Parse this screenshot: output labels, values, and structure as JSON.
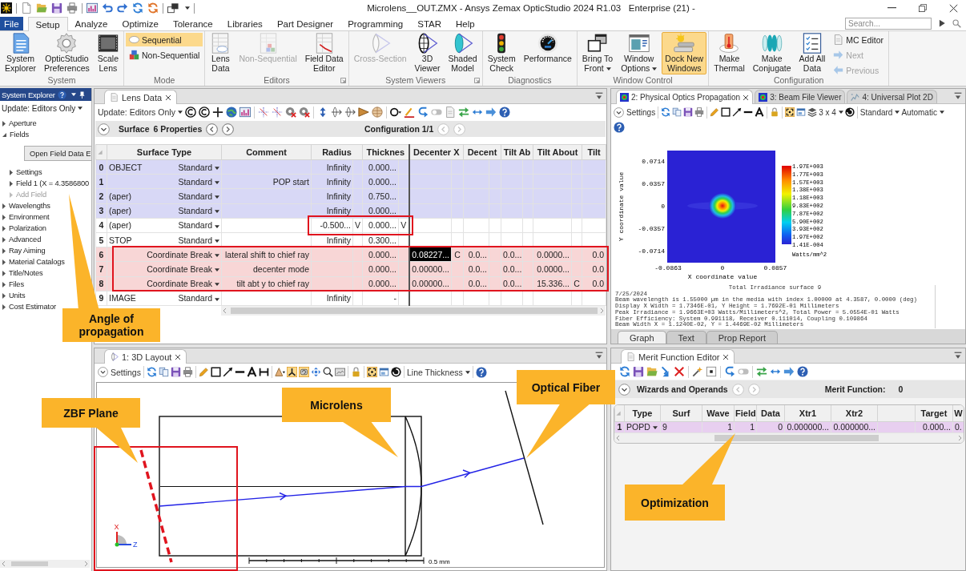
{
  "title_bar": {
    "title": "Microlens__OUT.ZMX - Ansys Zemax OpticStudio 2024 R1.03   Enterprise (21) -"
  },
  "ribbon": {
    "tabs": [
      {
        "label": "File",
        "kind": "file",
        "selected": false
      },
      {
        "label": "Setup",
        "kind": "tab",
        "selected": true
      },
      {
        "label": "Analyze",
        "kind": "tab",
        "selected": false
      },
      {
        "label": "Optimize",
        "kind": "tab",
        "selected": false
      },
      {
        "label": "Tolerance",
        "kind": "tab",
        "selected": false
      },
      {
        "label": "Libraries",
        "kind": "tab",
        "selected": false
      },
      {
        "label": "Part Designer",
        "kind": "tab",
        "selected": false
      },
      {
        "label": "Programming",
        "kind": "tab",
        "selected": false
      },
      {
        "label": "STAR",
        "kind": "tab",
        "selected": false
      },
      {
        "label": "Help",
        "kind": "tab",
        "selected": false
      }
    ],
    "search": {
      "placeholder": "Search..."
    },
    "groups": [
      {
        "label": "System",
        "launcher": false,
        "items": [
          {
            "label": "System\nExplorer",
            "kind": "large",
            "disabled": false,
            "on": false
          },
          {
            "label": "OpticStudio\nPreferences",
            "kind": "large",
            "disabled": false,
            "on": false
          },
          {
            "label": "Scale\nLens",
            "kind": "large",
            "disabled": false,
            "on": false
          }
        ]
      },
      {
        "label": "Mode",
        "launcher": false,
        "items": [
          {
            "label": "Sequential",
            "kind": "small",
            "disabled": false,
            "on": true
          },
          {
            "label": "Non-Sequential",
            "kind": "small",
            "disabled": false,
            "on": false
          }
        ]
      },
      {
        "label": "Editors",
        "launcher": true,
        "items": [
          {
            "label": "Lens\nData",
            "kind": "large",
            "disabled": false,
            "on": false
          },
          {
            "label": "Non-Sequential",
            "kind": "large",
            "disabled": true,
            "on": false
          },
          {
            "label": "Field Data\nEditor",
            "kind": "large",
            "disabled": false,
            "on": false
          }
        ]
      },
      {
        "label": "System Viewers",
        "launcher": true,
        "items": [
          {
            "label": "Cross-Section",
            "kind": "large",
            "disabled": true,
            "on": false
          },
          {
            "label": "3D\nViewer",
            "kind": "large",
            "disabled": false,
            "on": false
          },
          {
            "label": "Shaded\nModel",
            "kind": "large",
            "disabled": false,
            "on": false
          }
        ]
      },
      {
        "label": "Diagnostics",
        "launcher": false,
        "items": [
          {
            "label": "System\nCheck",
            "kind": "large",
            "disabled": false,
            "on": false
          },
          {
            "label": "Performance",
            "kind": "large",
            "disabled": false,
            "on": false
          }
        ]
      },
      {
        "label": "Window Control",
        "launcher": false,
        "items": [
          {
            "label": "Bring To\nFront",
            "kind": "split",
            "disabled": false,
            "on": false
          },
          {
            "label": "Window\nOptions",
            "kind": "split",
            "disabled": false,
            "on": false
          },
          {
            "label": "Dock New\nWindows",
            "kind": "large",
            "disabled": false,
            "on": true
          }
        ]
      },
      {
        "label": "Configuration",
        "launcher": false,
        "items": [
          {
            "label": "Make\nThermal",
            "kind": "large",
            "disabled": false,
            "on": false
          },
          {
            "label": "Make\nConjugate",
            "kind": "large",
            "disabled": false,
            "on": false
          },
          {
            "label": "Add All\nData",
            "kind": "large",
            "disabled": false,
            "on": false
          },
          {
            "label": "MC Editor",
            "kind": "small",
            "disabled": false,
            "on": false
          },
          {
            "label": "Next",
            "kind": "small",
            "disabled": true,
            "on": false
          },
          {
            "label": "Previous",
            "kind": "small",
            "disabled": true,
            "on": false
          }
        ]
      }
    ]
  },
  "system_explorer": {
    "title": "System Explorer",
    "update": "Update: Editors Only",
    "tree": [
      {
        "label": "Aperture",
        "expanded": false,
        "disabled": false
      },
      {
        "label": "Fields",
        "expanded": true,
        "disabled": false,
        "button": "Open Field Data E",
        "children": [
          {
            "label": "Settings",
            "expanded": false,
            "disabled": false
          },
          {
            "label": "Field 1 (X = 4.3586800",
            "expanded": false,
            "disabled": false
          },
          {
            "label": "Add Field",
            "expanded": false,
            "disabled": true
          }
        ]
      },
      {
        "label": "Wavelengths",
        "expanded": false,
        "disabled": false
      },
      {
        "label": "Environment",
        "expanded": false,
        "disabled": false
      },
      {
        "label": "Polarization",
        "expanded": false,
        "disabled": false
      },
      {
        "label": "Advanced",
        "expanded": false,
        "disabled": false
      },
      {
        "label": "Ray Aiming",
        "expanded": false,
        "disabled": false
      },
      {
        "label": "Material Catalogs",
        "expanded": false,
        "disabled": false
      },
      {
        "label": "Title/Notes",
        "expanded": false,
        "disabled": false
      },
      {
        "label": "Files",
        "expanded": false,
        "disabled": false
      },
      {
        "label": "Units",
        "expanded": false,
        "disabled": false
      },
      {
        "label": "Cost Estimator",
        "expanded": false,
        "disabled": false
      }
    ]
  },
  "lens_data": {
    "tabs": [
      {
        "label": "Lens Data",
        "selected": true
      }
    ],
    "update": "Update: Editors Only",
    "surface_bar": {
      "label": "Surface",
      "properties": "6 Properties",
      "nav": {
        "disabled": false
      },
      "configuration": "Configuration 1/1",
      "config_nav": {
        "disabled": true
      }
    },
    "columns": [
      "Surface Type",
      "Comment",
      "Radius",
      "Thicknes",
      "Decenter X",
      "Decent",
      "Tilt Ab",
      "Tilt About",
      "Tilt"
    ],
    "rows": [
      {
        "number": "0",
        "name": "OBJECT",
        "type": "Standard",
        "color": "#d8d8f6",
        "values": [
          {
            "text": "Infinity",
            "selected": false
          },
          {
            "text": "0.000...",
            "selected": false
          },
          {
            "selected": false
          },
          {
            "selected": false
          },
          {
            "selected": false
          },
          {
            "selected": false
          },
          {
            "selected": false
          }
        ]
      },
      {
        "number": "1",
        "type": "Standard",
        "comment": "POP start",
        "color": "#d8d8f6",
        "values": [
          {
            "text": "Infinity",
            "selected": false
          },
          {
            "text": "0.000...",
            "selected": false
          },
          {
            "selected": false
          },
          {
            "selected": false
          },
          {
            "selected": false
          },
          {
            "selected": false
          },
          {
            "selected": false
          }
        ]
      },
      {
        "number": "2",
        "name": "(aper)",
        "type": "Standard",
        "color": "#d8d8f6",
        "values": [
          {
            "text": "Infinity",
            "selected": false
          },
          {
            "text": "0.750...",
            "selected": false
          },
          {
            "selected": false
          },
          {
            "selected": false
          },
          {
            "selected": false
          },
          {
            "selected": false
          },
          {
            "selected": false
          }
        ]
      },
      {
        "number": "3",
        "name": "(aper)",
        "type": "Standard",
        "color": "#d8d8f6",
        "values": [
          {
            "text": "Infinity",
            "selected": false
          },
          {
            "text": "0.000...",
            "selected": false
          },
          {
            "selected": false
          },
          {
            "selected": false
          },
          {
            "selected": false
          },
          {
            "selected": false
          },
          {
            "selected": false
          }
        ]
      },
      {
        "number": "4",
        "name": "(aper)",
        "type": "Standard",
        "color": "#ffffff",
        "values": [
          {
            "text": "-0.500...",
            "solve": "V",
            "selected": false
          },
          {
            "text": "0.000...",
            "solve": "V",
            "selected": false
          },
          {
            "selected": false
          },
          {
            "selected": false
          },
          {
            "selected": false
          },
          {
            "selected": false
          },
          {
            "selected": false
          }
        ]
      },
      {
        "number": "5",
        "name": "STOP",
        "type": "Standard",
        "color": "#ffffff",
        "values": [
          {
            "text": "Infinity",
            "selected": false
          },
          {
            "text": "0.300...",
            "selected": false
          },
          {
            "selected": false
          },
          {
            "selected": false
          },
          {
            "selected": false
          },
          {
            "selected": false
          },
          {
            "selected": false
          }
        ]
      },
      {
        "number": "6",
        "type": "Coordinate Break",
        "comment": "lateral shift to chief ray",
        "color": "#f8d6d6",
        "values": [
          {
            "selected": false
          },
          {
            "text": "0.000...",
            "selected": false
          },
          {
            "text": "0.08227...",
            "solve": "C",
            "selected": true
          },
          {
            "text": "0.0...",
            "selected": false
          },
          {
            "text": "0.0...",
            "selected": false
          },
          {
            "text": "0.0000...",
            "selected": false
          },
          {
            "text": "0.0",
            "selected": false
          }
        ]
      },
      {
        "number": "7",
        "type": "Coordinate Break",
        "comment": "decenter mode",
        "color": "#f8d6d6",
        "values": [
          {
            "selected": false
          },
          {
            "text": "0.000...",
            "selected": false
          },
          {
            "text": "0.00000...",
            "selected": false
          },
          {
            "text": "0.0...",
            "selected": false
          },
          {
            "text": "0.0...",
            "selected": false
          },
          {
            "text": "0.0000...",
            "selected": false
          },
          {
            "text": "0.0",
            "selected": false
          }
        ]
      },
      {
        "number": "8",
        "type": "Coordinate Break",
        "comment": "tilt abt y to chief ray",
        "color": "#f8d6d6",
        "values": [
          {
            "selected": false
          },
          {
            "text": "0.000...",
            "selected": false
          },
          {
            "text": "0.00000...",
            "selected": false
          },
          {
            "text": "0.0...",
            "selected": false
          },
          {
            "text": "0.0...",
            "selected": false
          },
          {
            "text": "15.336...",
            "solve": "C",
            "selected": false
          },
          {
            "text": "0.0",
            "selected": false
          }
        ]
      },
      {
        "number": "9",
        "name": "IMAGE",
        "type": "Standard",
        "color": "#ffffff",
        "values": [
          {
            "text": "Infinity",
            "selected": false
          },
          {
            "text": "-",
            "selected": false
          },
          {
            "selected": false
          },
          {
            "selected": false
          },
          {
            "selected": false
          },
          {
            "selected": false
          },
          {
            "selected": false
          }
        ]
      }
    ]
  },
  "pop_window": {
    "tabs": [
      {
        "label": "2: Physical Optics Propagation",
        "selected": true
      },
      {
        "label": "3: Beam File Viewer",
        "selected": false
      },
      {
        "label": "4: Universal Plot 2D",
        "selected": false
      }
    ],
    "toolbar": {
      "settings": "Settings",
      "layout": "3 x 4",
      "style": "Standard",
      "scale": "Automatic"
    },
    "plot": {
      "ylabel": "Y coordinate value",
      "xlabel": "X coordinate value",
      "yticks": [
        "0.0714",
        "0.0357",
        "0",
        "-0.0357",
        "-0.0714"
      ],
      "xticks": [
        "-0.0863",
        "0",
        "0.0857"
      ],
      "colorbar": [
        "1.97E+003",
        "1.77E+003",
        "1.57E+003",
        "1.38E+003",
        "1.18E+003",
        "9.83E+002",
        "7.87E+002",
        "5.90E+002",
        "3.93E+002",
        "1.97E+002",
        "1.41E-004"
      ],
      "unit": "Watts/mm^2"
    },
    "report": {
      "title": "Total Irradiance surface 9",
      "lines": [
        "7/25/2024",
        "Beam wavelength is 1.55000 µm in the media with index 1.00000 at 4.3587, 0.0000 (deg)",
        "Display X Width = 1.7346E-01, Y Height = 1.7692E-01 Millimeters",
        "Peak Irradiance = 1.9663E+03 Watts/Millimeters^2, Total Power = 5.0554E-01 Watts",
        "Fiber Efficiency: System 0.991118, Receiver 0.111014, Coupling 0.109864",
        "Beam Width X = 1.1240E-02, Y = 1.4469E-02 Millimeters"
      ]
    },
    "bottom_tabs": [
      {
        "label": "Graph",
        "selected": true
      },
      {
        "label": "Text",
        "selected": false
      },
      {
        "label": "Prop Report",
        "selected": false
      }
    ]
  },
  "layout_window": {
    "tabs": [
      {
        "label": "1: 3D Layout",
        "selected": true
      }
    ],
    "toolbar": {
      "settings": "Settings",
      "line_thickness": "Line Thickness"
    },
    "drawing": {
      "scale_label": "0.5 mm",
      "axis_x": "X",
      "axis_z": "Z"
    }
  },
  "merit_editor": {
    "tabs": [
      {
        "label": "Merit Function Editor",
        "selected": true
      }
    ],
    "bar": {
      "label": "Wizards and Operands",
      "nav": {
        "disabled": true
      },
      "merit_label": "Merit Function:",
      "merit_value": "0"
    },
    "columns": [
      {
        "label": "Type"
      },
      {
        "label": "Surf"
      },
      {
        "label": "Wave"
      },
      {
        "label": "Field"
      },
      {
        "label": "Data"
      },
      {
        "label": "Xtr1"
      },
      {
        "label": "Xtr2"
      },
      {},
      {
        "label": "Target"
      },
      {
        "label": "W"
      }
    ],
    "rows": [
      {
        "number": "1",
        "color": "#e8cff0",
        "cells": [
          {
            "text": "POPD"
          },
          {
            "text": "9"
          },
          {
            "text": "1"
          },
          {
            "text": "1"
          },
          {
            "text": "0"
          },
          {
            "text": "0.000000..."
          },
          {
            "text": "0.000000..."
          },
          {},
          {
            "text": "0.000..."
          },
          {
            "text": "0."
          }
        ]
      }
    ]
  },
  "annotations": [
    {
      "text": "Angle of propagation"
    },
    {
      "text": "ZBF Plane"
    },
    {
      "text": "Microlens"
    },
    {
      "text": "Optical Fiber"
    },
    {
      "text": "Optimization"
    }
  ]
}
